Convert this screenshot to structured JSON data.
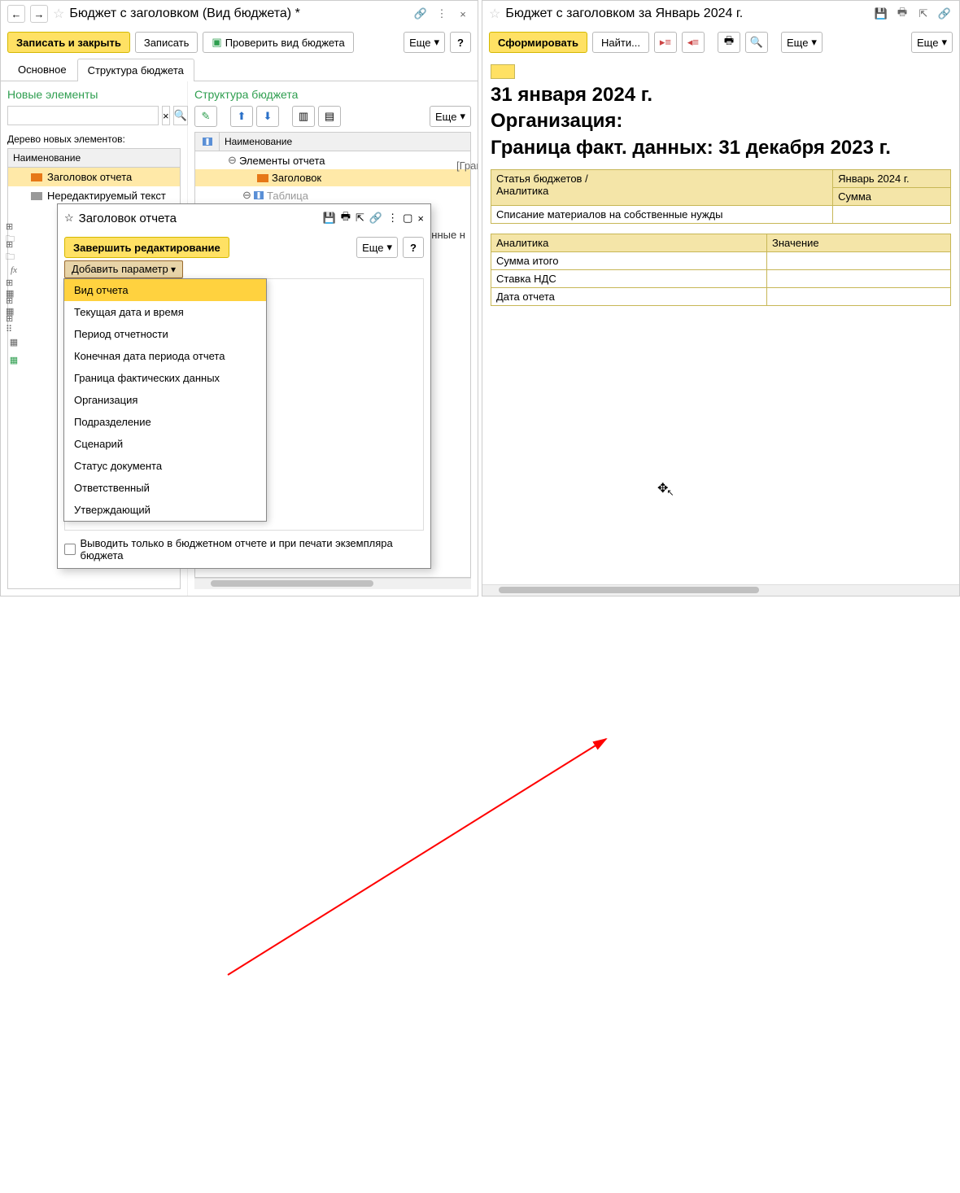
{
  "left": {
    "title": "Бюджет с заголовком (Вид бюджета) *",
    "toolbar": {
      "save_close": "Записать и закрыть",
      "save": "Записать",
      "check": "Проверить вид бюджета",
      "more": "Еще",
      "help": "?"
    },
    "tabs": {
      "main": "Основное",
      "structure": "Структура бюджета"
    },
    "new_elements_title": "Новые элементы",
    "tree_caption": "Дерево новых элементов:",
    "tree_header": "Наименование",
    "tree_items": [
      {
        "label": "Заголовок отчета",
        "selected": true,
        "icon": "orange"
      },
      {
        "label": "Нередактируемый текст",
        "selected": false,
        "icon": "gray"
      }
    ],
    "struct_title": "Структура бюджета",
    "struct_more": "Еще",
    "struct_header": "Наименование",
    "struct_items": [
      {
        "level": 0,
        "label": "Элементы отчета",
        "selected": false,
        "exp": "⊖",
        "icon": ""
      },
      {
        "level": 1,
        "label": "Заголовок",
        "selected": true,
        "exp": "",
        "icon": "orange"
      },
      {
        "level": 1,
        "label": "Таблица",
        "selected": false,
        "exp": "⊖",
        "icon": "table"
      }
    ],
    "hidden_line": "[ГраницаФактическихДанных]",
    "hidden_row": "вственные н"
  },
  "popup": {
    "title": "Заголовок отчета",
    "finish": "Завершить редактирование",
    "more": "Еще",
    "help": "?",
    "add_param": "Добавить параметр",
    "menu": [
      "Вид отчета",
      "Текущая дата и время",
      "Период отчетности",
      "Конечная дата периода отчета",
      "Граница фактических данных",
      "Организация",
      "Подразделение",
      "Сценарий",
      "Статус документа",
      "Ответственный",
      "Утверждающий"
    ],
    "checkbox_label": "Выводить только в бюджетном отчете и при печати экземпляра бюджета"
  },
  "right": {
    "title": "Бюджет с заголовком  за Январь 2024 г.",
    "toolbar": {
      "generate": "Сформировать",
      "find": "Найти...",
      "more": "Еще",
      "more2": "Еще"
    },
    "heading1": "31 января 2024 г.",
    "heading2": "Организация:",
    "heading3": "Граница факт. данных: 31 декабря 2023 г.",
    "table1": {
      "h1a": "Статья бюджетов /",
      "h1b": "Аналитика",
      "h2": "Январь 2024 г.",
      "h3": "Сумма",
      "row1": "Списание материалов на собственные нужды"
    },
    "table2": {
      "h1": "Аналитика",
      "h2": "Значение",
      "r1": "Сумма итого",
      "r2": "Ставка НДС",
      "r3": "Дата отчета"
    }
  }
}
